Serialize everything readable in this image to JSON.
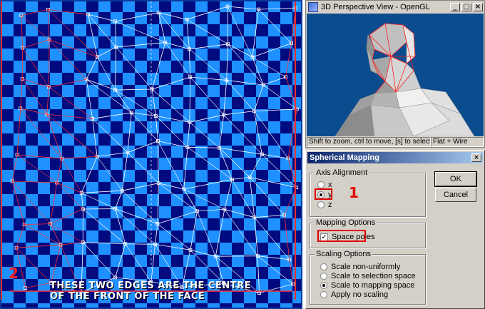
{
  "uv_editor": {
    "caption_line1": "THESE TWO EDGES ARE THE CENTRE",
    "caption_line2": "OF THE FRONT OF THE FACE",
    "annotation_number": "2"
  },
  "viewport_window": {
    "title": "3D Perspective View - OpenGL",
    "status_text": "Shift to zoom, ctrl to move, [s] to select",
    "render_mode": "Flat + Wire",
    "buttons": {
      "minimize": "_",
      "maximize": "□",
      "close": "×"
    }
  },
  "dialog": {
    "title": "Spherical Mapping",
    "close": "×",
    "axis_group": {
      "label": "Axis Alignment",
      "options": [
        "x",
        "y",
        "z"
      ],
      "selected": "y"
    },
    "mapping_group": {
      "label": "Mapping Options",
      "space_poles_label": "Space poles",
      "space_poles_checked": true
    },
    "scaling_group": {
      "label": "Scaling Options",
      "options": [
        "Scale non-uniformly",
        "Scale to selection space",
        "Scale to mapping space",
        "Apply no scaling"
      ],
      "selected": "Scale to mapping space"
    },
    "ok_label": "OK",
    "cancel_label": "Cancel",
    "annotation_number": "1"
  },
  "colors": {
    "checker_light": "#1e90ff",
    "checker_dark": "#000b80",
    "wire": "#ffffff",
    "seam": "#ff2020",
    "viewport_bg": "#0b4c8e"
  }
}
